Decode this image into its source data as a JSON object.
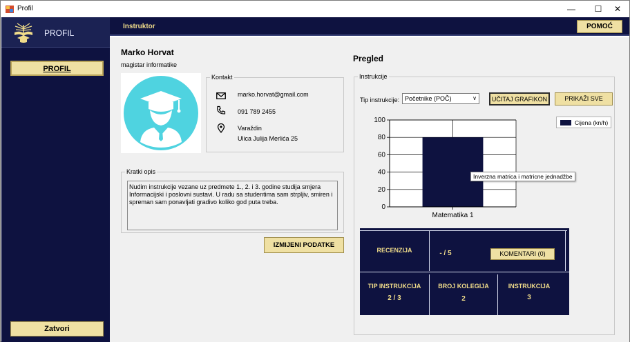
{
  "window": {
    "title": "Profil",
    "minimize": "—",
    "maximize": "☐",
    "close": "✕"
  },
  "sidebar": {
    "brand": "PROFIL",
    "profil_button": "PROFIL",
    "close_button": "Zatvori"
  },
  "header": {
    "section_title": "Instruktor",
    "help_button": "POMOĆ"
  },
  "profile": {
    "name": "Marko Horvat",
    "degree": "magistar informatike",
    "contact_legend": "Kontakt",
    "email": "marko.horvat@gmail.com",
    "phone": "091 789 2455",
    "city": "Varaždin",
    "street": "Ulica Julija Merlića 25",
    "description_legend": "Kratki opis",
    "description": "Nudim instrukcije vezane uz predmete 1., 2. i 3. godine studija smjera Informacijski i poslovni sustavi. U radu sa studentima sam strpljiv, smiren i spreman sam ponavljati gradivo koliko god puta treba.",
    "edit_button": "IZMIJENI PODATKE"
  },
  "overview": {
    "title": "Pregled",
    "group_legend": "Instrukcije",
    "type_label": "Tip instrukcije:",
    "type_selected": "Početnike (POČ)",
    "load_chart_button": "UČITAJ GRAFIKON",
    "show_all_button": "PRIKAŽI SVE",
    "tooltip": "Inverzna matrica i matricne jednadžbe"
  },
  "chart_data": {
    "type": "bar",
    "categories": [
      "Matematika 1"
    ],
    "series": [
      {
        "name": "Cijena (kn/h)",
        "values": [
          80
        ],
        "color": "#0e1240"
      }
    ],
    "yticks": [
      "0",
      "20",
      "40",
      "60",
      "80",
      "100"
    ],
    "ylim": [
      0,
      100
    ],
    "legend_position": "top-right",
    "grid": true
  },
  "stats": {
    "review_label": "RECENZIJA",
    "review_value": "- / 5",
    "comments_button": "KOMENTARI (0)",
    "type_label": "TIP INSTRUKCIJA",
    "type_value": "2 / 3",
    "colleagues_label": "BROJ KOLEGIJA",
    "colleagues_value": "2",
    "instructions_label": "INSTRUKCIJA",
    "instructions_value": "3"
  },
  "colors": {
    "navy": "#0e1240",
    "gold_button": "#efe0a3",
    "gold_text": "#f0dc8a",
    "avatar_cyan": "#4fd3e0"
  }
}
